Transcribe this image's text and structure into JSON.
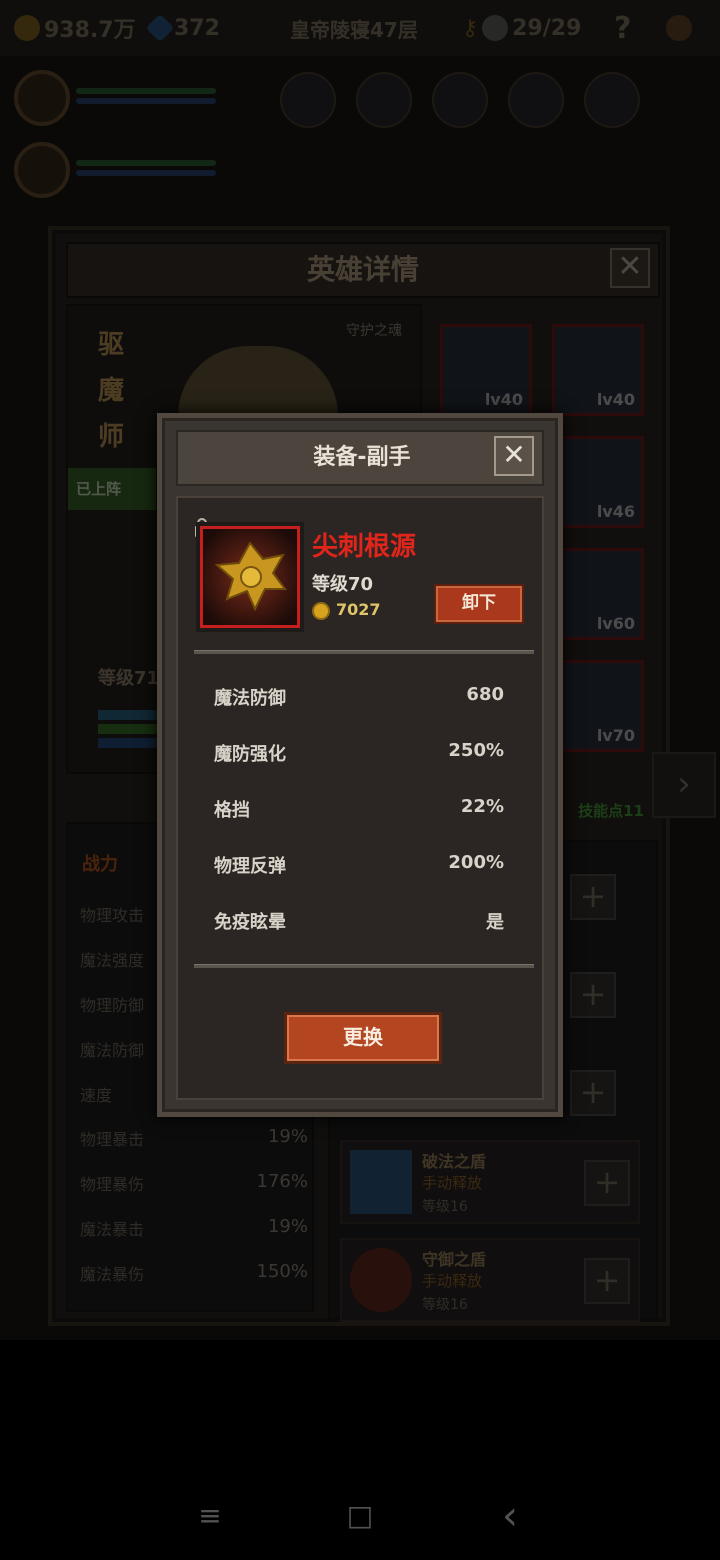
{
  "topbar": {
    "gold": "938.7万",
    "gems": "372",
    "stage": "皇帝陵寝47层",
    "keys": "29/29",
    "help": "?"
  },
  "hero_panel": {
    "title": "英雄详情",
    "close": "✕",
    "hero_name": "驱魔师",
    "guard_label": "守护之魂",
    "deployed": "已上阵",
    "level": "等级71",
    "equipment_levels": [
      "lv40",
      "lv40",
      "lv46",
      "lv60",
      "lv70"
    ],
    "skill_points": "技能点11",
    "stats_title": "战力",
    "stats": [
      {
        "name": "物理攻击",
        "value": ""
      },
      {
        "name": "魔法强度",
        "value": ""
      },
      {
        "name": "物理防御",
        "value": ""
      },
      {
        "name": "魔法防御",
        "value": ""
      },
      {
        "name": "速度",
        "value": ""
      },
      {
        "name": "物理暴击",
        "value": "19%"
      },
      {
        "name": "物理暴伤",
        "value": "176%"
      },
      {
        "name": "魔法暴击",
        "value": "19%"
      },
      {
        "name": "魔法暴伤",
        "value": "150%"
      }
    ],
    "skills": [
      {
        "name": "破法之盾",
        "activation": "手动释放",
        "level": "等级16"
      },
      {
        "name": "守御之盾",
        "activation": "手动释放",
        "level": "等级16"
      }
    ],
    "plus": "+"
  },
  "modal": {
    "title": "装备-副手",
    "close": "✕",
    "item_name": "尖刺根源",
    "item_level": "等级70",
    "price": "7027",
    "unequip_button": "卸下",
    "attributes": [
      {
        "name": "魔法防御",
        "value": "680"
      },
      {
        "name": "魔防强化",
        "value": "250%"
      },
      {
        "name": "格挡",
        "value": "22%"
      },
      {
        "name": "物理反弹",
        "value": "200%"
      },
      {
        "name": "免疫眩晕",
        "value": "是"
      }
    ],
    "replace_button": "更换"
  },
  "navbar": {
    "menu": "≡",
    "home": "□",
    "back": "‹"
  },
  "colors": {
    "item_name": "#e1251b",
    "button_orange": "#b34520",
    "frame_red": "#c61f1f",
    "skill_points": "#47a33a"
  }
}
